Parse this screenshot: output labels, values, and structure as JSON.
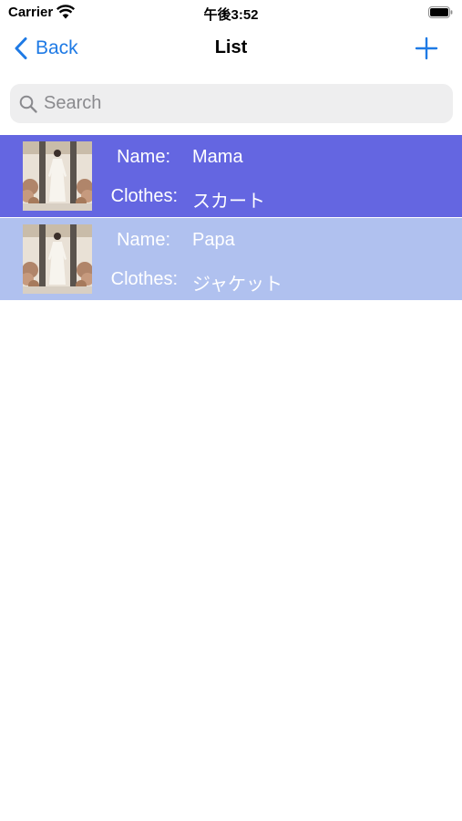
{
  "status_bar": {
    "carrier": "Carrier",
    "time": "午後3:52"
  },
  "nav": {
    "back_label": "Back",
    "title": "List",
    "add_icon": "plus-icon"
  },
  "search": {
    "placeholder": "Search",
    "value": ""
  },
  "list": {
    "name_label": "Name:",
    "clothes_label": "Clothes:",
    "items": [
      {
        "name": "Mama",
        "clothes": "スカート",
        "bg_color": "#6466e1"
      },
      {
        "name": "Papa",
        "clothes": "ジャケット",
        "bg_color": "#b0c1ef"
      }
    ]
  },
  "colors": {
    "accent": "#1e7ae5",
    "search_bg": "#eeeeef"
  }
}
